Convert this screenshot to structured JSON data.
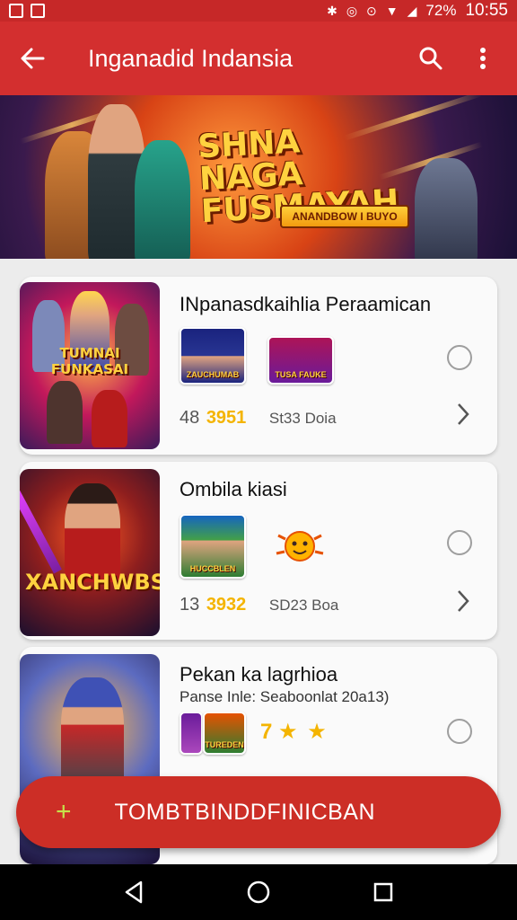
{
  "status_bar": {
    "battery": "72%",
    "time": "10:55"
  },
  "app_bar": {
    "title": "Inganadid Indansia"
  },
  "banner": {
    "title_line1": "SHNA NAGA",
    "title_line2": "FUSMAYAH",
    "cta": "ANANDBOW I BUYO"
  },
  "cards": [
    {
      "title": "INpanasdkaihlia Peraamican",
      "thumb_label": "TUMNAI FUNKASAI",
      "mini_labels": [
        "ZAUCHUMAB",
        "TUSA FAUKE"
      ],
      "stat_num": "48",
      "stat_gold": "3951",
      "price": "St33 Doia"
    },
    {
      "title": "Ombila kiasi",
      "thumb_label": "XANCHWBS",
      "mini_labels": [
        "HUCCBLEN"
      ],
      "stat_num": "13",
      "stat_gold": "3932",
      "price": "SD23 Boa"
    },
    {
      "title": "Pekan ka lagrhioa",
      "subtitle": "Panse Inle: Seaboonlat 20a13)",
      "mini_labels": [
        "",
        "TUREDEN"
      ],
      "rating_text": "7"
    }
  ],
  "fab": {
    "label": "TOMBTBINDDFINICBAN"
  },
  "colors": {
    "primary": "#d32f2f",
    "accent_gold": "#f4b400",
    "fab": "#cc2e26"
  }
}
